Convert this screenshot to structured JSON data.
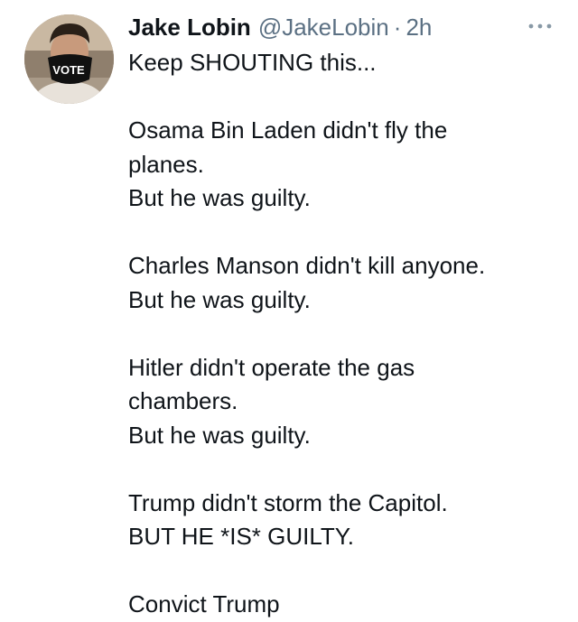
{
  "tweet": {
    "author": {
      "display_name": "Jake Lobin",
      "handle": "@JakeLobin",
      "separator": "·",
      "time": "2h",
      "avatar_mask_text": "VOTE"
    },
    "more_icon": "ellipsis-icon",
    "lines": [
      "Keep SHOUTING this...",
      "",
      "Osama Bin Laden didn't fly the",
      "planes.",
      "But he was guilty.",
      "",
      "Charles Manson didn't kill anyone.",
      "But he was guilty.",
      "",
      "Hitler didn't operate the gas",
      "chambers.",
      "But he was guilty.",
      "",
      "Trump didn't storm the Capitol.",
      "BUT HE *IS* GUILTY.",
      "",
      "Convict Trump"
    ]
  },
  "colors": {
    "text": "#0f1419",
    "secondary": "#5b7083",
    "background": "#ffffff"
  }
}
